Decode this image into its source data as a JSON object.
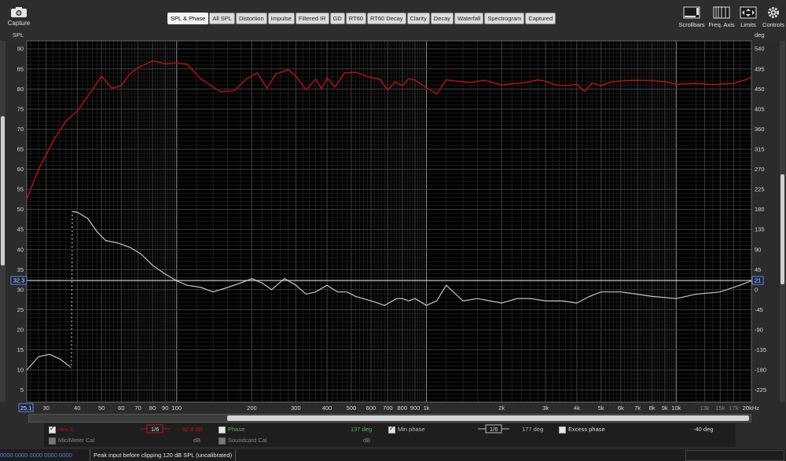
{
  "toolbar": {
    "capture_label": "Capture",
    "tabs": [
      "SPL & Phase",
      "All SPL",
      "Distortion",
      "Impulse",
      "Filtered IR",
      "GD",
      "RT60",
      "RT60 Decay",
      "Clarity",
      "Decay",
      "Waterfall",
      "Spectrogram",
      "Captured"
    ],
    "active_tab": "SPL & Phase",
    "right_tools": [
      "Scrollbars",
      "Freq. Axis",
      "Limits",
      "Controls"
    ]
  },
  "axis_units": {
    "left": "SPL",
    "right": "deg"
  },
  "chart_data": {
    "type": "line",
    "x_scale": "log",
    "xlim": [
      25.1,
      20000
    ],
    "x_tick_labels": [
      "25.1",
      "30",
      "40",
      "50",
      "60",
      "70",
      "80",
      "90",
      "100",
      "200",
      "300",
      "400",
      "500",
      "600",
      "700",
      "800",
      "900",
      "1k",
      "2k",
      "3k",
      "4k",
      "5k",
      "6k",
      "7k",
      "8k",
      "9k",
      "10k",
      "13k",
      "15k",
      "17k",
      "20kHz"
    ],
    "x_tick_values": [
      25.1,
      30,
      40,
      50,
      60,
      70,
      80,
      90,
      100,
      200,
      300,
      400,
      500,
      600,
      700,
      800,
      900,
      1000,
      2000,
      3000,
      4000,
      5000,
      6000,
      7000,
      8000,
      9000,
      10000,
      13000,
      15000,
      17000,
      20000
    ],
    "ylim_left": [
      2,
      92
    ],
    "y_ticks_left": [
      5,
      10,
      15,
      20,
      25,
      30,
      35,
      40,
      45,
      50,
      55,
      60,
      65,
      70,
      75,
      80,
      85,
      90
    ],
    "ylim_right": [
      -252,
      558
    ],
    "y_ticks_right": [
      -225,
      -180,
      -135,
      -90,
      -45,
      0,
      45,
      90,
      135,
      180,
      225,
      270,
      315,
      360,
      405,
      450,
      495,
      540
    ],
    "cursor": {
      "left_value": "32.3",
      "right_value": "21",
      "x_value": "25.1"
    },
    "grid": true,
    "series": [
      {
        "name": "нен 3",
        "axis": "left",
        "color": "#c01010",
        "x": [
          25.1,
          28,
          32,
          36,
          40,
          45,
          50,
          55,
          60,
          65,
          70,
          80,
          90,
          100,
          110,
          125,
          150,
          170,
          190,
          210,
          230,
          250,
          280,
          300,
          330,
          360,
          380,
          400,
          430,
          470,
          520,
          600,
          650,
          700,
          750,
          800,
          850,
          900,
          1000,
          1100,
          1200,
          1300,
          1500,
          1700,
          2000,
          2200,
          2500,
          2800,
          3000,
          3300,
          3600,
          4000,
          4300,
          4600,
          5000,
          5500,
          6000,
          7000,
          8000,
          9000,
          10000,
          12000,
          14000,
          17000,
          20000
        ],
        "y": [
          52.5,
          60,
          67,
          72,
          74.5,
          79,
          83.2,
          80.2,
          80.8,
          83.8,
          85.3,
          87,
          86.3,
          86.5,
          86.2,
          82.5,
          79.3,
          79.6,
          82.5,
          84,
          80.2,
          83.8,
          84.8,
          83.2,
          79.8,
          82.5,
          80,
          82.8,
          80.5,
          84,
          84.2,
          82.8,
          82.5,
          79.7,
          81.8,
          80.8,
          82.6,
          82.2,
          80.3,
          78.8,
          82.3,
          82,
          81.6,
          82.2,
          81,
          81.3,
          81.6,
          82.3,
          81.9,
          81,
          80.8,
          81.2,
          79.4,
          81.5,
          80.8,
          81.8,
          82,
          82.2,
          82.1,
          81.8,
          81.2,
          81.4,
          81.1,
          81.4,
          82.8
        ]
      },
      {
        "name": "Phase",
        "axis": "right",
        "color": "#c4c4c4",
        "x": [
          25.1,
          28,
          31,
          34,
          37.9,
          38.2,
          40,
          44,
          48,
          52,
          58,
          65,
          72,
          80,
          90,
          100,
          110,
          125,
          140,
          160,
          180,
          200,
          220,
          240,
          270,
          300,
          330,
          360,
          400,
          440,
          480,
          520,
          600,
          680,
          760,
          800,
          850,
          900,
          1000,
          1100,
          1200,
          1400,
          1600,
          1800,
          2000,
          2300,
          2600,
          3000,
          3500,
          4000,
          4500,
          5000,
          6000,
          7000,
          8000,
          10000,
          12000,
          15000,
          18000,
          20000
        ],
        "y": [
          -180,
          -150,
          -145,
          -155,
          -175,
          175,
          174,
          160,
          130,
          110,
          105,
          95,
          80,
          55,
          35,
          20,
          10,
          5,
          -5,
          5,
          15,
          25,
          15,
          0,
          25,
          10,
          -10,
          -5,
          10,
          -5,
          -5,
          -15,
          -25,
          -35,
          -20,
          -20,
          -25,
          -20,
          -35,
          -25,
          10,
          -25,
          -20,
          -25,
          -30,
          -20,
          -20,
          -25,
          -25,
          -30,
          -15,
          -5,
          -5,
          -10,
          -15,
          -20,
          -10,
          -5,
          10,
          20
        ]
      }
    ]
  },
  "legend": {
    "row1": [
      {
        "label": "нен 3",
        "checked": true,
        "value": "82.8 dB",
        "smoothing": "1/6"
      },
      {
        "label": "Phase",
        "checked": false,
        "value": "137 deg"
      },
      {
        "label": "Min phase",
        "checked": true,
        "value": "177 deg",
        "smoothing": "1/6"
      },
      {
        "label": "Excess phase",
        "checked": false,
        "value": "-40 deg"
      }
    ],
    "row2": [
      {
        "label": "Mic/Meter Cal",
        "value": "dB"
      },
      {
        "label": "Soundcard Cal",
        "value": "dB"
      }
    ]
  },
  "status": {
    "meters": "0000  0000 0000  0000 0000",
    "message": "Peak input before clipping 120 dB SPL (uncalibrated)"
  },
  "colors": {
    "background": "#000000",
    "grid": "#2e2e2e",
    "spl": "#c01010",
    "phase": "#c4c4c4",
    "cursor": "#e8e8e8"
  }
}
